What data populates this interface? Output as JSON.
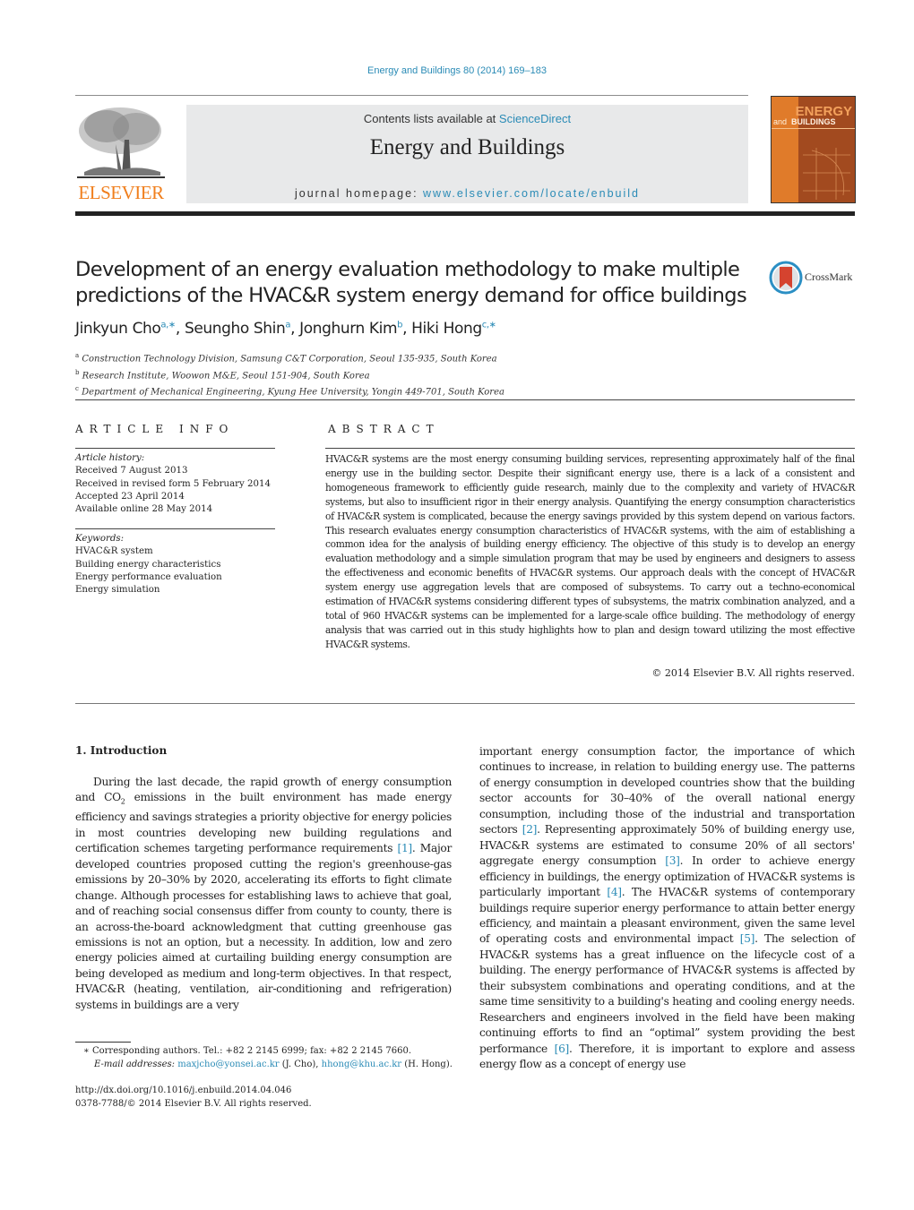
{
  "header": {
    "journal_reference": "Energy and Buildings 80 (2014) 169–183",
    "contents_prefix": "Contents lists available at ",
    "contents_link": "ScienceDirect",
    "journal_title": "Energy and Buildings",
    "homepage_prefix": "journal homepage: ",
    "homepage_link": "www.elsevier.com/locate/enbuild",
    "publisher_logo_text": "ELSEVIER",
    "cover": {
      "word1": "ENERGY",
      "word2": "and",
      "word3": "BUILDINGS"
    },
    "brand_color": "#f07f1d",
    "link_color": "#2a8bb6"
  },
  "article": {
    "title_line1": "Development of an energy evaluation methodology to make multiple",
    "title_line2": "predictions of the HVAC&R system energy demand for office buildings",
    "crossmark_label": "CrossMark",
    "authors": [
      {
        "name": "Jinkyun Cho",
        "sup": "a,∗"
      },
      {
        "name": "Seungho Shin",
        "sup": "a"
      },
      {
        "name": "Jonghurn Kim",
        "sup": "b"
      },
      {
        "name": "Hiki Hong",
        "sup": "c,∗"
      }
    ],
    "affiliations": [
      {
        "mark": "a",
        "text": "Construction Technology Division, Samsung C&T Corporation, Seoul 135-935, South Korea"
      },
      {
        "mark": "b",
        "text": "Research Institute, Woowon M&E, Seoul 151-904, South Korea"
      },
      {
        "mark": "c",
        "text": "Department of Mechanical Engineering, Kyung Hee University, Yongin 449-701, South Korea"
      }
    ]
  },
  "article_info": {
    "heading": "ARTICLE INFO",
    "history_label": "Article history:",
    "history": [
      "Received 7 August 2013",
      "Received in revised form 5 February 2014",
      "Accepted 23 April 2014",
      "Available online 28 May 2014"
    ],
    "keywords_label": "Keywords:",
    "keywords": [
      "HVAC&R system",
      "Building energy characteristics",
      "Energy performance evaluation",
      "Energy simulation"
    ]
  },
  "abstract": {
    "heading": "ABSTRACT",
    "text": "HVAC&R systems are the most energy consuming building services, representing approximately half of the final energy use in the building sector. Despite their significant energy use, there is a lack of a consistent and homogeneous framework to efficiently guide research, mainly due to the complexity and variety of HVAC&R systems, but also to insufficient rigor in their energy analysis. Quantifying the energy consumption characteristics of HVAC&R system is complicated, because the energy savings provided by this system depend on various factors. This research evaluates energy consumption characteristics of HVAC&R systems, with the aim of establishing a common idea for the analysis of building energy efficiency. The objective of this study is to develop an energy evaluation methodology and a simple simulation program that may be used by engineers and designers to assess the effectiveness and economic benefits of HVAC&R systems. Our approach deals with the concept of HVAC&R system energy use aggregation levels that are composed of subsystems. To carry out a techno-economical estimation of HVAC&R systems considering different types of subsystems, the matrix combination analyzed, and a total of 960 HVAC&R systems can be implemented for a large-scale office building. The methodology of energy analysis that was carried out in this study highlights how to plan and design toward utilizing the most effective HVAC&R systems.",
    "copyright": "© 2014 Elsevier B.V. All rights reserved."
  },
  "introduction": {
    "heading": "1.  Introduction",
    "left": {
      "p1": "During the last decade, the rapid growth of energy consumption and CO",
      "p1_sub": "2",
      "p2": " emissions in the built environment has made energy efficiency and savings strategies a priority objective for energy policies in most countries developing new building regulations and certification schemes targeting performance requirements ",
      "cite1": "[1]",
      "p3": ". Major developed countries proposed cutting the region's greenhouse-gas emissions by 20–30% by 2020, accelerating its efforts to fight climate change. Although processes for establishing laws to achieve that goal, and of reaching social consensus differ from county to county, there is an across-the-board acknowledgment that cutting greenhouse gas emissions is not an option, but a necessity. In addition, low and zero energy policies aimed at curtailing building energy consumption are being developed as medium and long-term objectives. In that respect, HVAC&R (heating, ventilation, air-conditioning and refrigeration) systems in buildings are a very"
    },
    "right": {
      "s1": "important energy consumption factor, the importance of which continues to increase, in relation to building energy use. The patterns of energy consumption in developed countries show that the building sector accounts for 30–40% of the overall national energy consumption, including those of the industrial and transportation sectors ",
      "cite2": "[2]",
      "s2": ". Representing approximately 50% of building energy use, HVAC&R systems are estimated to consume 20% of all sectors' aggregate energy consumption ",
      "cite3": "[3]",
      "s3": ". In order to achieve energy efficiency in buildings, the energy optimization of HVAC&R systems is particularly important ",
      "cite4": "[4]",
      "s4": ". The HVAC&R systems of contemporary buildings require superior energy performance to attain better energy efficiency, and maintain a pleasant environment, given the same level of operating costs and environmental impact ",
      "cite5": "[5]",
      "s5": ". The selection of HVAC&R systems has a great influence on the lifecycle cost of a building. The energy performance of HVAC&R systems is affected by their subsystem combinations and operating conditions, and at the same time sensitivity to a building's heating and cooling energy needs. Researchers and engineers involved in the field have been making continuing efforts to find an “optimal” system providing the best performance ",
      "cite6": "[6]",
      "s6": ". Therefore, it is important to explore and assess energy flow as a concept of energy use"
    }
  },
  "footnotes": {
    "star": "∗",
    "corresponding": "Corresponding authors. Tel.: +82 2 2145 6999; fax: +82 2 2145 7660.",
    "email_label": "E-mail addresses:",
    "email1": "maxjcho@yonsei.ac.kr",
    "email1_owner": " (J. Cho), ",
    "email2": "hhong@khu.ac.kr",
    "email2_owner": " (H. Hong).",
    "doi": "http://dx.doi.org/10.1016/j.enbuild.2014.04.046",
    "issn": "0378-7788/© 2014 Elsevier B.V. All rights reserved."
  }
}
